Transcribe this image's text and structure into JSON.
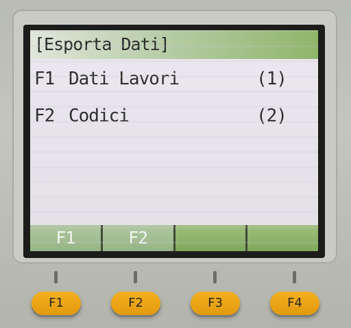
{
  "screen": {
    "title": "[Esporta Dati]",
    "menu_items": [
      {
        "key": "F1",
        "label": "Dati Lavori",
        "count": "(1)"
      },
      {
        "key": "F2",
        "label": "Codici",
        "count": "(2)"
      }
    ],
    "softkeys": [
      "F1",
      "F2",
      "",
      ""
    ]
  },
  "hardware_keys": [
    "F1",
    "F2",
    "F3",
    "F4"
  ],
  "colors": {
    "key_accent": "#f0a818",
    "softkey_green": "#8cb464",
    "lcd_background": "#e9e5ec"
  }
}
